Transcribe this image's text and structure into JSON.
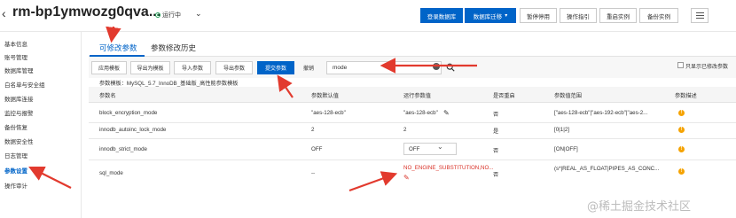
{
  "header": {
    "title": "rm-bp1ymwozg0qva...",
    "status": "运行中",
    "buttons": {
      "login_db": "登录数据库",
      "migrate_db": "数据库迁移",
      "pause": "暂停停用",
      "guide": "操作指引",
      "restart": "重启实例",
      "backup": "备份实例"
    }
  },
  "sidebar": {
    "items": [
      {
        "label": "基本信息"
      },
      {
        "label": "账号管理"
      },
      {
        "label": "数据库管理"
      },
      {
        "label": "白名单与安全组"
      },
      {
        "label": "数据库连接"
      },
      {
        "label": "监控与报警"
      },
      {
        "label": "备份恢复"
      },
      {
        "label": "数据安全性"
      },
      {
        "label": "日志管理"
      },
      {
        "label": "参数设置"
      },
      {
        "label": "操作审计"
      }
    ],
    "active_index": 9
  },
  "tabs": [
    {
      "label": "可修改参数"
    },
    {
      "label": "参数修改历史"
    }
  ],
  "toolbar": {
    "apply_template": "应用模板",
    "export_template": "导出为模板",
    "import_params": "导入参数",
    "export_params": "导出参数",
    "submit_params": "提交参数",
    "undo": "撤销",
    "search_value": "mode",
    "show_only_modified": "只显示已修改参数"
  },
  "template_line": "参数模板：MySQL_5.7_InnoDB_基础版_高性能参数模板",
  "table": {
    "headers": [
      "参数名",
      "参数默认值",
      "运行参数值",
      "是否重启",
      "参数值范围",
      "参数描述"
    ],
    "rows": [
      {
        "name": "block_encryption_mode",
        "default": "\"aes-128-ecb\"",
        "running": "\"aes-128-ecb\"",
        "restart": "否",
        "range": "[\"aes-128-ecb\"|\"aes-192-ecb\"|\"aes-2..."
      },
      {
        "name": "innodb_autoinc_lock_mode",
        "default": "2",
        "running": "2",
        "restart": "是",
        "range": "[0|1|2]"
      },
      {
        "name": "innodb_strict_mode",
        "default": "OFF",
        "running": "OFF",
        "restart": "否",
        "range": "[ON|OFF]"
      },
      {
        "name": "sql_mode",
        "default": "--",
        "running": "NO_ENGINE_SUBSTITUTION,NO...",
        "restart": "否",
        "range": "(s*|REAL_AS_FLOAT|PIPES_AS_CONC..."
      }
    ]
  },
  "watermark": "@稀土掘金技术社区",
  "colors": {
    "primary": "#0064c8",
    "arrow": "#e23a2e",
    "modified": "#d93026",
    "info": "#f5a300"
  }
}
